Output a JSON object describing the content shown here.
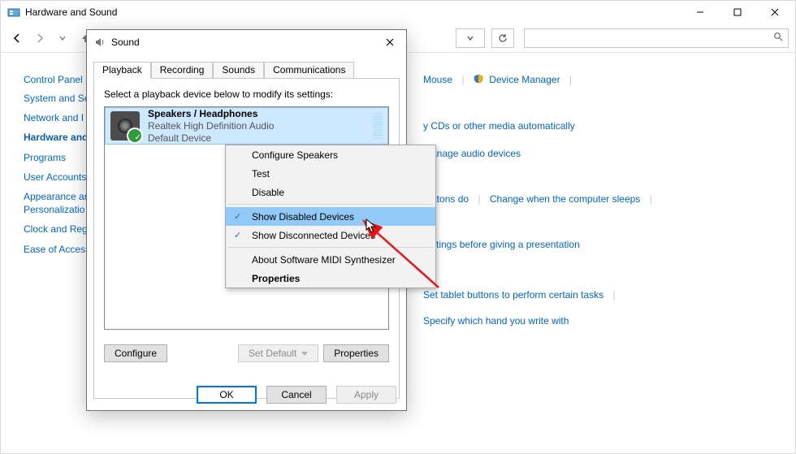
{
  "window": {
    "title": "Hardware and Sound"
  },
  "toolbar": {
    "search_placeholder": ""
  },
  "sidebar": {
    "head": "Control Panel …",
    "items": [
      {
        "label": "System and Se"
      },
      {
        "label": "Network and I"
      },
      {
        "label": "Hardware and",
        "active": true
      },
      {
        "label": "Programs"
      },
      {
        "label": "User Accounts"
      },
      {
        "label": "Appearance an\nPersonalizatio"
      },
      {
        "label": "Clock and Reg"
      },
      {
        "label": "Ease of Access"
      }
    ]
  },
  "content": {
    "rows": [
      {
        "links": [
          {
            "text": "Mouse"
          },
          {
            "shield": true,
            "text": "Device Manager"
          }
        ]
      },
      {
        "links": [
          {
            "text": "y CDs or other media automatically"
          }
        ]
      },
      {
        "links": [
          {
            "text": "Manage audio devices"
          }
        ]
      },
      {
        "links": [
          {
            "text": "buttons do"
          },
          {
            "text": "Change when the computer sleeps"
          }
        ]
      },
      {
        "links": [
          {
            "text": "settings before giving a presentation"
          }
        ]
      },
      {
        "links": [
          {
            "text": "Set tablet buttons to perform certain tasks"
          }
        ]
      },
      {
        "links": [
          {
            "text": "Specify which hand you write with"
          }
        ]
      }
    ]
  },
  "dialog": {
    "title": "Sound",
    "tabs": [
      "Playback",
      "Recording",
      "Sounds",
      "Communications"
    ],
    "active_tab": 0,
    "instruction": "Select a playback device below to modify its settings:",
    "device": {
      "name": "Speakers / Headphones",
      "driver": "Realtek High Definition Audio",
      "status": "Default Device"
    },
    "buttons": {
      "configure": "Configure",
      "set_default": "Set Default",
      "properties": "Properties",
      "ok": "OK",
      "cancel": "Cancel",
      "apply": "Apply"
    }
  },
  "context_menu": {
    "items": [
      {
        "label": "Configure Speakers"
      },
      {
        "label": "Test"
      },
      {
        "label": "Disable"
      },
      {
        "sep": true
      },
      {
        "label": "Show Disabled Devices",
        "checked": true,
        "highlight": true
      },
      {
        "label": "Show Disconnected Devices",
        "checked": true
      },
      {
        "sep": true
      },
      {
        "label": "About Software MIDI Synthesizer"
      },
      {
        "label": "Properties",
        "bold": true
      }
    ]
  }
}
